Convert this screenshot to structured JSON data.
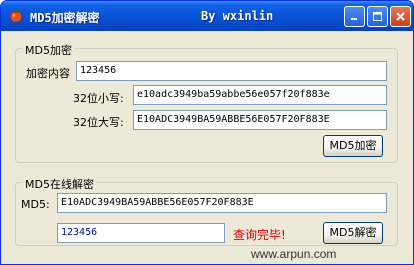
{
  "window": {
    "title": "MD5加密解密",
    "author": "By wxinlin"
  },
  "encrypt_group": {
    "legend": "MD5加密",
    "content_label": "加密内容",
    "content_value": "123456",
    "lower_label": "32位小写:",
    "lower_value": "e10adc3949ba59abbe56e057f20f883e",
    "upper_label": "32位大写:",
    "upper_value": "E10ADC3949BA59ABBE56E057F20F883E",
    "encrypt_button": "MD5加密"
  },
  "decrypt_group": {
    "legend": "MD5在线解密",
    "md5_label": "MD5:",
    "md5_value": "E10ADC3949BA59ABBE56E057F20F883E",
    "result_value": "123456",
    "status_text": "查询完毕!",
    "decrypt_button": "MD5解密"
  },
  "watermark": "www.arpun.com",
  "icons": {
    "app": "apple-icon",
    "minimize": "minimize-icon",
    "maximize": "maximize-icon",
    "close": "close-icon"
  },
  "colors": {
    "titlebar": "#0a53d6",
    "status": "#e00000",
    "result_text": "#0010a0"
  }
}
